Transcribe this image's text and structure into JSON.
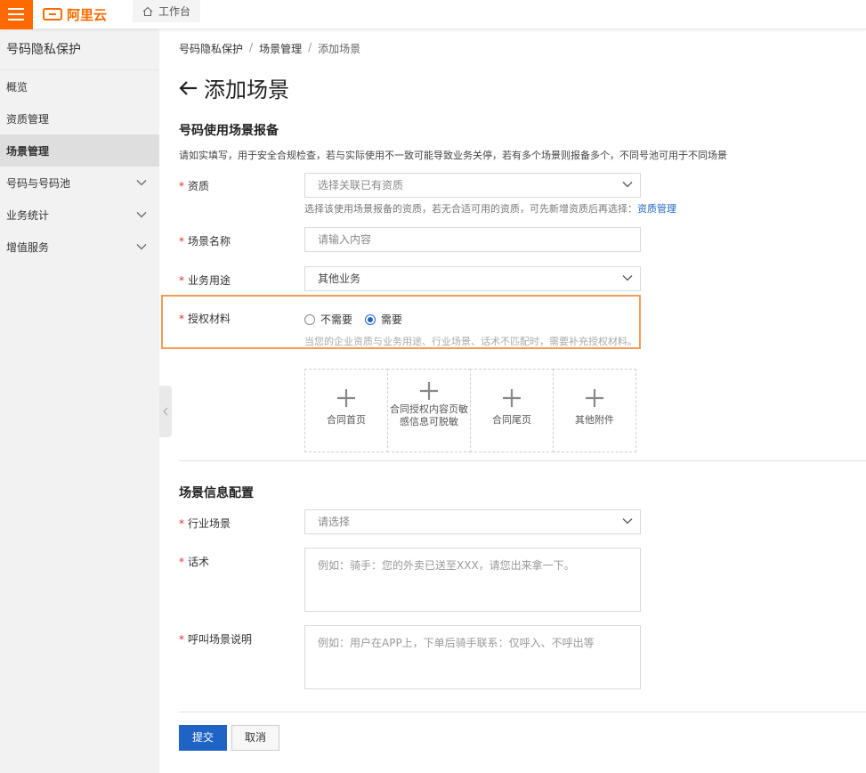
{
  "topbar": {
    "logo_text": "阿里云",
    "workbench_label": "工作台"
  },
  "sidebar": {
    "title": "号码隐私保护",
    "items": [
      {
        "label": "概览",
        "expandable": false,
        "active": false
      },
      {
        "label": "资质管理",
        "expandable": false,
        "active": false
      },
      {
        "label": "场景管理",
        "expandable": false,
        "active": true
      },
      {
        "label": "号码与号码池",
        "expandable": true,
        "active": false
      },
      {
        "label": "业务统计",
        "expandable": true,
        "active": false
      },
      {
        "label": "增值服务",
        "expandable": true,
        "active": false
      }
    ]
  },
  "breadcrumb": {
    "items": [
      "号码隐私保护",
      "场景管理",
      "添加场景"
    ],
    "separator": "/"
  },
  "page": {
    "title": "添加场景"
  },
  "section1": {
    "title": "号码使用场景报备",
    "description": "请如实填写，用于安全合规检查，若与实际使用不一致可能导致业务关停，若有多个场景则报备多个，不同号池可用于不同场景",
    "qualification": {
      "label": "资质",
      "placeholder": "选择关联已有资质",
      "hint": "选择该使用场景报备的资质，若无合适可用的资质，可先新增资质后再选择：",
      "hint_link": "资质管理"
    },
    "scene_name": {
      "label": "场景名称",
      "placeholder": "请输入内容"
    },
    "business_use": {
      "label": "业务用途",
      "value": "其他业务"
    },
    "auth_material": {
      "label": "授权材料",
      "options": [
        "不需要",
        "需要"
      ],
      "selected": "需要",
      "hint": "当您的企业资质与业务用途、行业场景、话术不匹配时，需要补充授权材料。"
    },
    "uploads": [
      {
        "label": "合同首页"
      },
      {
        "label": "合同授权内容页敏感信息可脱敏"
      },
      {
        "label": "合同尾页"
      },
      {
        "label": "其他附件"
      }
    ]
  },
  "section2": {
    "title": "场景信息配置",
    "industry": {
      "label": "行业场景",
      "placeholder": "请选择"
    },
    "script": {
      "label": "话术",
      "placeholder": "例如：骑手：您的外卖已送至XXX，请您出来拿一下。"
    },
    "call_desc": {
      "label": "呼叫场景说明",
      "placeholder": "例如：用户在APP上，下单后骑手联系：仅呼入、不呼出等"
    }
  },
  "actions": {
    "submit": "提交",
    "cancel": "取消"
  },
  "colors": {
    "brand": "#ff6a00",
    "primary": "#1f64c4",
    "required": "#e62c2c",
    "highlight": "#f79a54"
  }
}
